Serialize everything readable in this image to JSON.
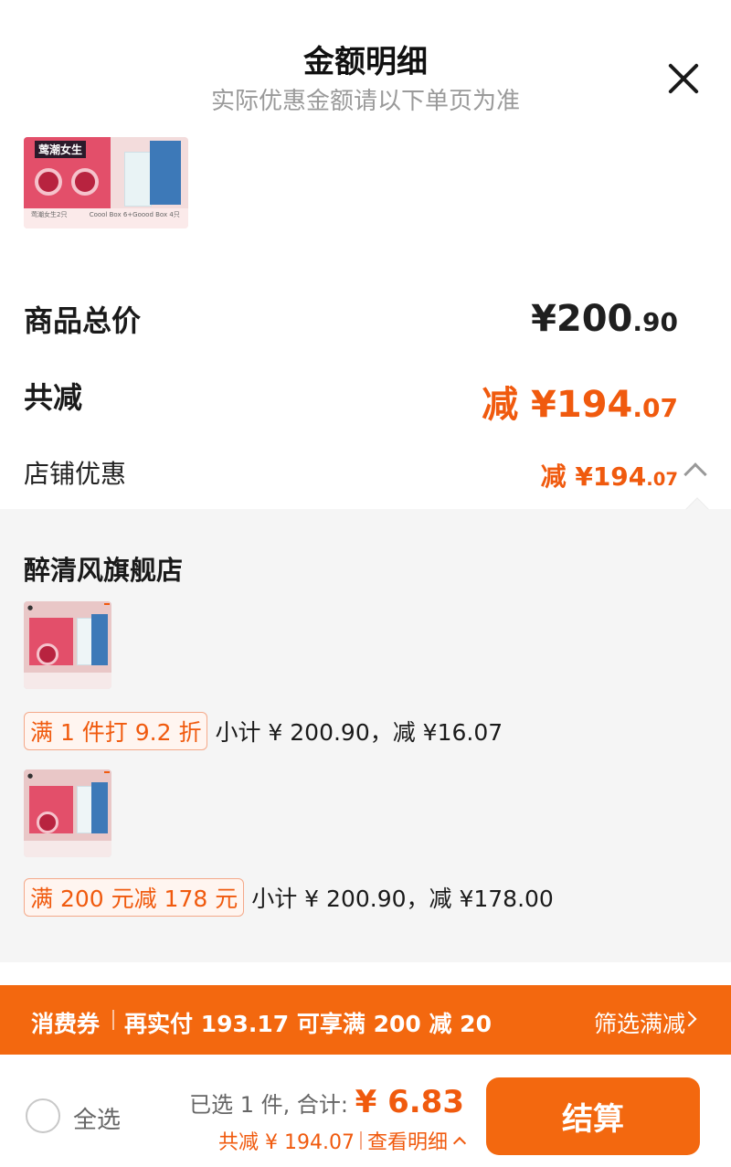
{
  "header": {
    "title": "金额明细",
    "subtitle": "实际优惠金额请以下单页为准"
  },
  "top_thumbnail": {
    "badge": "莺潮女生",
    "caption_left": "莺潮女生2只",
    "caption_right": "Coool Box 6+Goood Box 4只"
  },
  "summary": {
    "total_label": "商品总价",
    "total_int": "¥200",
    "total_dec": ".90",
    "reduce_label": "共减",
    "reduce_int": "减 ¥194",
    "reduce_dec": ".07",
    "shop_label": "店铺优惠",
    "shop_int": "减 ¥194",
    "shop_dec": ".07"
  },
  "detail": {
    "store_name": "醉清风旗舰店",
    "promos": [
      {
        "tag": "满 1 件打 9.2 折",
        "text": "小计 ¥ 200.90，减 ¥16.07"
      },
      {
        "tag": "满 200 元减 178 元",
        "text": "小计 ¥ 200.90，减 ¥178.00"
      }
    ]
  },
  "coupon": {
    "label": "消费券",
    "text": "再实付 193.17 可享满 200 减 20",
    "filter": "筛选满减"
  },
  "bottom": {
    "select_all": "全选",
    "selected_prefix": "已选 1 件, 合计: ",
    "selected_amount": "¥ 6.83",
    "reduce_text": "共减 ¥ 194.07",
    "detail_link": "查看明细",
    "checkout": "结算"
  },
  "colors": {
    "accent": "#f05a0e",
    "coupon_bar": "#f3680f",
    "panel_bg": "#f5f5f5"
  }
}
